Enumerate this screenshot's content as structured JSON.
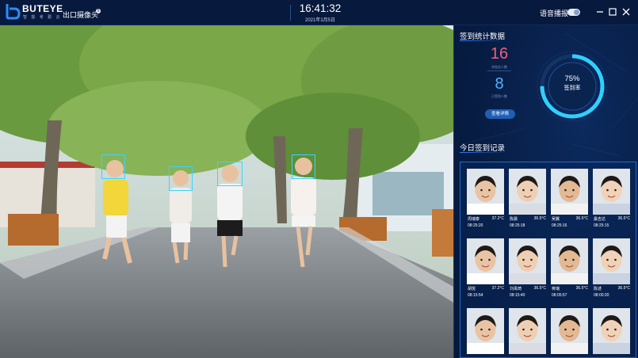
{
  "header": {
    "brand": "BUTEYE",
    "brand_sub": "智 能 考 勤 云",
    "camera_title": "出口摄像头",
    "camera_badge": "5",
    "time": "16:41:32",
    "date": "2021年1月5日",
    "voice_label": "语音播报",
    "voice_on": true
  },
  "stats": {
    "title": "签到统计数据",
    "total": "16",
    "total_label": "学校总人数",
    "signed": "8",
    "signed_label": "已签到人数",
    "details_button": "查看详情",
    "rate": 0.75,
    "rate_text": "75%",
    "rate_label": "签到率"
  },
  "records": {
    "title": "今日签到记录",
    "items": [
      {
        "name": "周瑞泰",
        "temp": "37.2°C",
        "time": "08:25:20"
      },
      {
        "name": "陈晨",
        "temp": "36.5°C",
        "time": "08:25:18"
      },
      {
        "name": "吴翼",
        "temp": "36.5°C",
        "time": "08:25:16"
      },
      {
        "name": "桑吉达",
        "temp": "36.5°C",
        "time": "08:25:15"
      },
      {
        "name": "胡悦",
        "temp": "37.2°C",
        "time": "08:15:54"
      },
      {
        "name": "刘禹琦",
        "temp": "36.5°C",
        "time": "08:15:40"
      },
      {
        "name": "蒋瑞",
        "temp": "36.5°C",
        "time": "08:05:57"
      },
      {
        "name": "陈述",
        "temp": "36.5°C",
        "time": "08:00:20"
      },
      {
        "name": "",
        "temp": "",
        "time": ""
      },
      {
        "name": "",
        "temp": "",
        "time": ""
      },
      {
        "name": "",
        "temp": "",
        "time": ""
      },
      {
        "name": "",
        "temp": "",
        "time": ""
      }
    ]
  },
  "colors": {
    "accent": "#1f5fb3",
    "total_number": "#f0607a",
    "signed_number": "#4fb3ff",
    "face_box": "#3ad4ff",
    "gauge_arc": "#2fd0ff"
  }
}
